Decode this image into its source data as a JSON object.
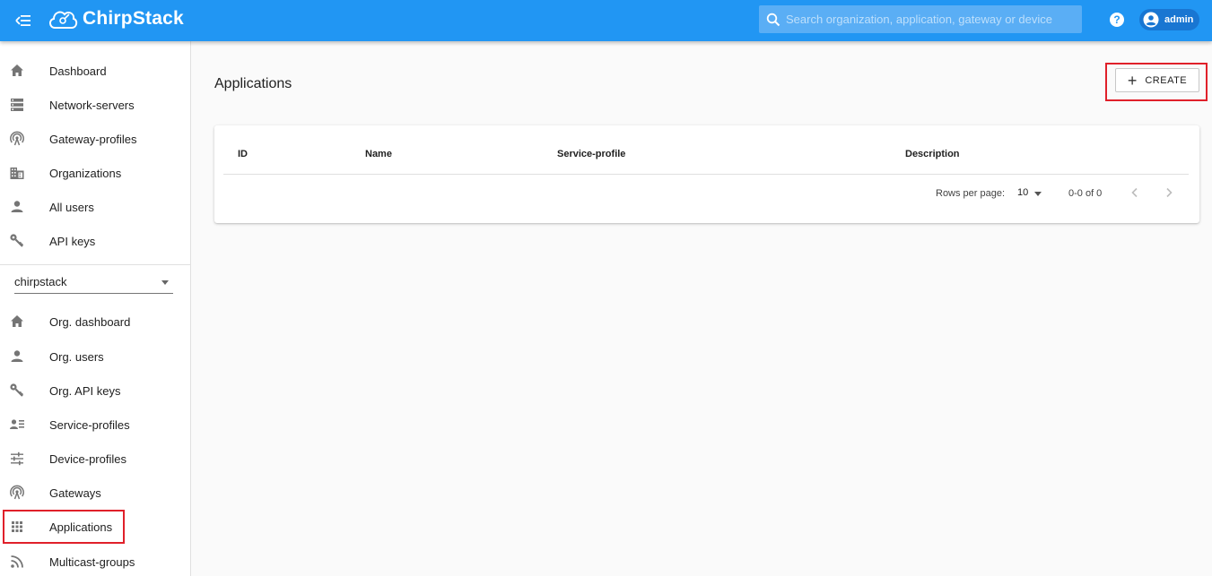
{
  "app": {
    "name": "ChirpStack"
  },
  "search": {
    "placeholder": "Search organization, application, gateway or device"
  },
  "user": {
    "name": "admin"
  },
  "sidebar": {
    "global_items": [
      {
        "label": "Dashboard",
        "icon": "home-icon"
      },
      {
        "label": "Network-servers",
        "icon": "server-icon"
      },
      {
        "label": "Gateway-profiles",
        "icon": "antenna-icon"
      },
      {
        "label": "Organizations",
        "icon": "building-icon"
      },
      {
        "label": "All users",
        "icon": "person-icon"
      },
      {
        "label": "API keys",
        "icon": "key-icon"
      }
    ],
    "organization": {
      "selected": "chirpstack"
    },
    "org_items": [
      {
        "label": "Org. dashboard",
        "icon": "home-icon"
      },
      {
        "label": "Org. users",
        "icon": "person-icon"
      },
      {
        "label": "Org. API keys",
        "icon": "key-icon"
      },
      {
        "label": "Service-profiles",
        "icon": "account-details-icon"
      },
      {
        "label": "Device-profiles",
        "icon": "tune-icon"
      },
      {
        "label": "Gateways",
        "icon": "antenna-icon"
      },
      {
        "label": "Applications",
        "icon": "apps-icon"
      },
      {
        "label": "Multicast-groups",
        "icon": "rss-icon"
      }
    ]
  },
  "main": {
    "title": "Applications",
    "create_label": "CREATE",
    "table": {
      "columns": [
        "ID",
        "Name",
        "Service-profile",
        "Description"
      ],
      "rows": []
    },
    "pagination": {
      "rows_per_page_label": "Rows per page:",
      "rows_per_page": "10",
      "range": "0-0 of 0"
    }
  },
  "colors": {
    "primary": "#2196f3",
    "highlight": "#e0202a"
  }
}
